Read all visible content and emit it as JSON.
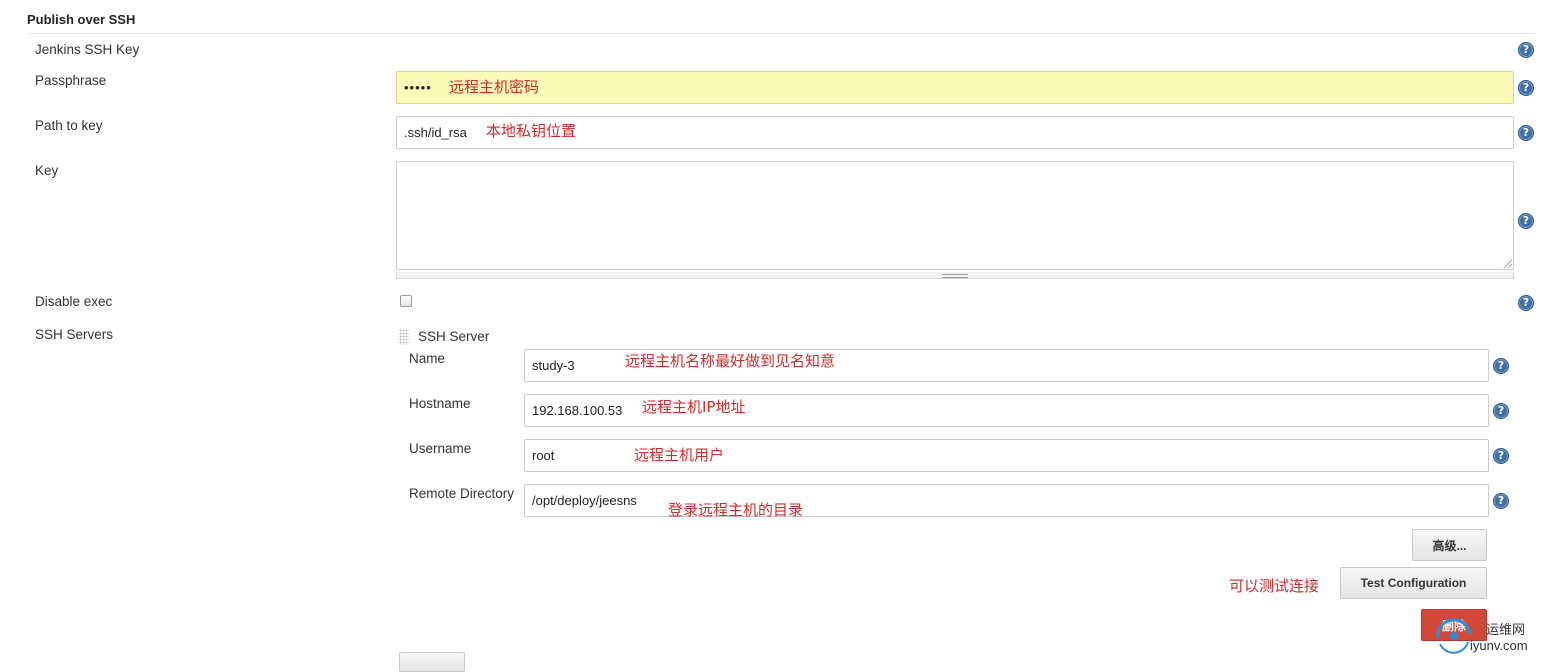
{
  "section": {
    "title": "Publish over SSH"
  },
  "fields": {
    "jenkins_ssh_key": {
      "label": "Jenkins SSH Key"
    },
    "passphrase": {
      "label": "Passphrase",
      "value": "•••••",
      "note": "远程主机密码"
    },
    "path_to_key": {
      "label": "Path to key",
      "value": ".ssh/id_rsa",
      "note": "本地私钥位置"
    },
    "key": {
      "label": "Key",
      "value": ""
    },
    "disable_exec": {
      "label": "Disable exec",
      "checked": false
    },
    "ssh_servers": {
      "label": "SSH Servers"
    }
  },
  "ssh_server": {
    "header": "SSH Server",
    "name": {
      "label": "Name",
      "value": "study-3",
      "note": "远程主机名称最好做到见名知意"
    },
    "hostname": {
      "label": "Hostname",
      "value": "192.168.100.53",
      "note": "远程主机IP地址"
    },
    "username": {
      "label": "Username",
      "value": "root",
      "note": "远程主机用户"
    },
    "remote_directory": {
      "label": "Remote Directory",
      "value": "/opt/deploy/jeesns",
      "note": "登录远程主机的目录"
    },
    "advanced_button": "高级...",
    "test_note": "可以测试连接",
    "test_button": "Test Configuration",
    "delete_button": "删除"
  },
  "help_icon": "?",
  "watermark": {
    "line1": "运维网",
    "line2": "iyunv.com"
  },
  "colors": {
    "annotation": "#d22b2b",
    "passphrase_bg": "#fafab9",
    "help_icon": "#3f6fa6",
    "delete_button": "#d24939"
  },
  "icons": [
    "help-icon",
    "drag-handle-icon",
    "resize-grip-icon",
    "watermark-logo-icon"
  ]
}
